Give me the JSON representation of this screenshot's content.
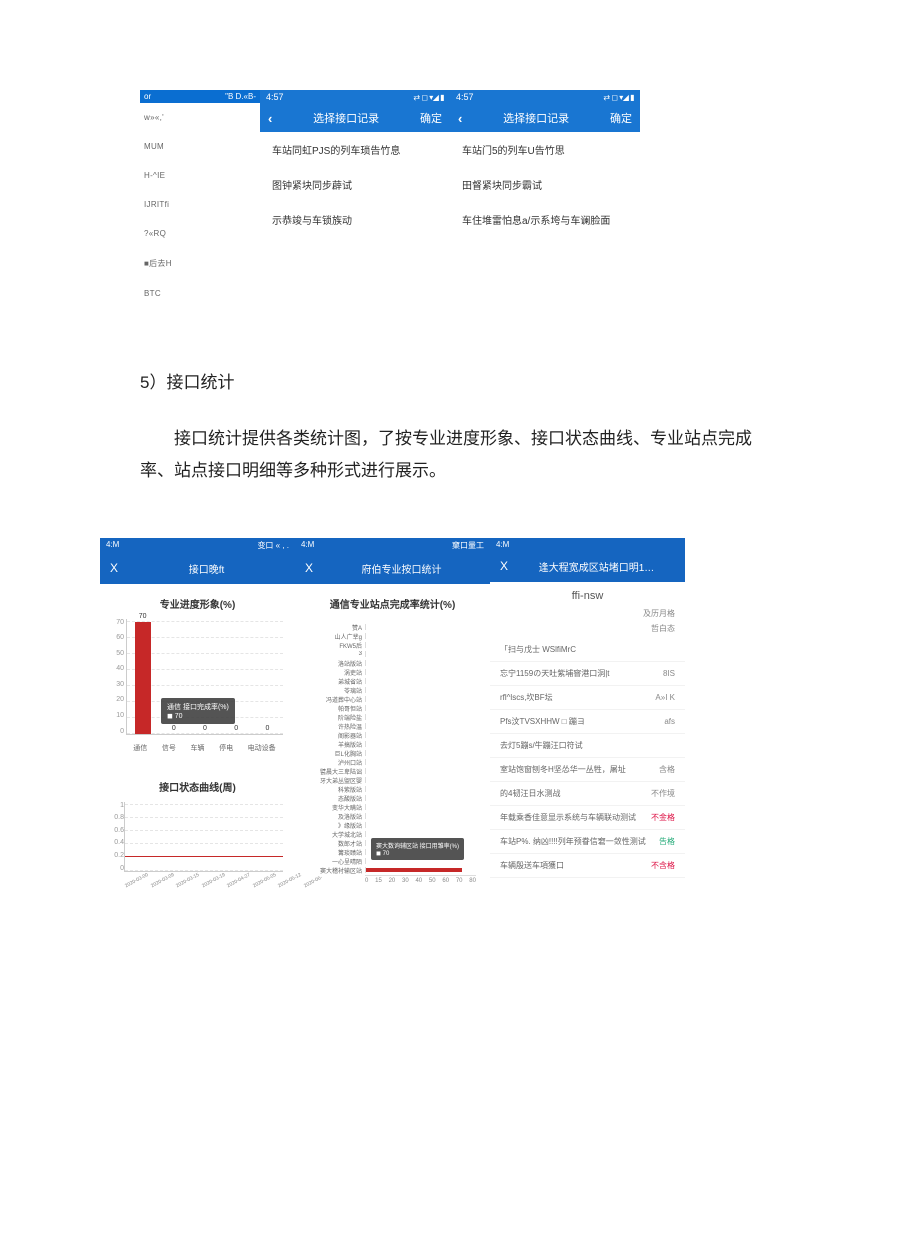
{
  "top_row": {
    "phone_a": {
      "hdr_left": "or",
      "hdr_right": "\"B D.«B-",
      "items": [
        "w»«,'",
        "MUM",
        "H-^IE",
        "IJRITfi",
        "?«RQ",
        "■后去H",
        "BTC"
      ]
    },
    "phone_b": {
      "time": "4:57",
      "status_icons": "⇄ ◻ ▾◢ ▮",
      "back": "‹",
      "title": "选择接口记录",
      "action": "确定",
      "items": [
        "车站同虹PJS的列车琐告竹息",
        "图钟紧块同步薜试",
        "示恭竣与车锁族动"
      ]
    },
    "phone_c": {
      "time": "4:57",
      "status_icons": "⇄ ◻ ▾◢ ▮",
      "back": "‹",
      "title": "选择接口记录",
      "action": "确定",
      "items": [
        "车站门5的列车U告竹思",
        "田督紧块同步霸试",
        "车住堆雷怕息a/示系垮与车谰脸面"
      ]
    }
  },
  "section": {
    "heading": "5）接口统计",
    "para": "接口统计提供各类统计图，了按专业进度形象、接口状态曲线、专业站点完成率、站点接口明细等多种形式进行展示。"
  },
  "bottom_row": {
    "phone_a": {
      "sb_left": "4:M",
      "sb_right": "变口 « , .",
      "close": "X",
      "title": "接口晚ft",
      "chart1_title": "专业进度形象(%)",
      "chart2_title": "接口状态曲线(周)"
    },
    "phone_b": {
      "sb_left": "4:M",
      "sb_right": "窠口量工",
      "close": "X",
      "title": "府伯专业按口统计",
      "chart_title": "通信专业站点完成率统计(%)"
    },
    "phone_c": {
      "sb_left": "4:M",
      "sb_right": "",
      "close": "X",
      "title": "逢大程宽成区站堵口明1…",
      "sub": "ffi-nsw",
      "tag1": "及历月格",
      "tag2": "哲白态",
      "rows": [
        {
          "l": "「扫与戊士 WSlfiMrC",
          "v": ""
        },
        {
          "l": "忘宁1159の天吐紫埔窨港口洞|t",
          "v": "8IS"
        },
        {
          "l": "rfl^lscs,坎BF坛",
          "v": "A»I K"
        },
        {
          "l": "Pfs汶TVSXHHW □ 蹦ヨ",
          "v": "afs"
        },
        {
          "l": "去灯5蹦s/牛蹦汪口符试",
          "v": ""
        },
        {
          "l": "室站饱窗刨冬H坚怂华一丛牲，屠址",
          "v": "含格"
        },
        {
          "l": "的4韧汪日水测战",
          "v": "不作境"
        },
        {
          "l": "年载乘香佳意显示系统与车辆联动测试",
          "v": "不金格",
          "cls": "red"
        },
        {
          "l": "车站P%.  纳凶!!!!列年预眷信窘一敛性测试",
          "v": "告格",
          "cls": "green"
        },
        {
          "l": "车辆殷送车項獲口",
          "v": "不含格",
          "cls": "red"
        }
      ]
    }
  },
  "chart_data": [
    {
      "type": "bar",
      "title": "专业进度形象(%)",
      "categories": [
        "通信",
        "信号",
        "车辆",
        "停电",
        "电动设备"
      ],
      "values": [
        70,
        0,
        0,
        0,
        0
      ],
      "ylim": [
        0,
        70
      ],
      "yticks": [
        0,
        10,
        20,
        30,
        40,
        50,
        60,
        70
      ],
      "legend": {
        "label": "通信 接口完成率(%)",
        "value": 70
      }
    },
    {
      "type": "line",
      "title": "接口状态曲线(周)",
      "x": [
        "2020-03-00",
        "2020-03-09",
        "2020-03-15",
        "2020-03-19",
        "2020-04-27",
        "2020-05-05",
        "2020-05-12",
        "2020-06-"
      ],
      "y": [
        0.2,
        0.2,
        0.2,
        0.2,
        0.2,
        0.2,
        0.2,
        0.2
      ],
      "ylim": [
        0,
        1
      ],
      "yticks": [
        0,
        0.2,
        0.4,
        0.6,
        0.8,
        1
      ]
    },
    {
      "type": "bar",
      "orientation": "horizontal",
      "title": "通信专业站点完成率统计(%)",
      "categories": [
        "赞A",
        "山人广丵g",
        "FKW5后",
        "3",
        "洛站版站",
        "涡吏站",
        "弟城省站",
        "苓璃站",
        "冯道葬中心站",
        "帕哥怛站",
        "阶端险盐",
        "许热险温",
        "阁影器站",
        "羊搞版站",
        "巨L化胸站",
        "泸州口站",
        "甓晨大三卑陆诎",
        "牙大弟丛盥区婴",
        "科紫版站",
        "态酸版站",
        "变华大瞒站",
        "及洛版站",
        "》缘版站",
        "大学城北站",
        "数郎才站",
        "篝琰赜站",
        "一心呈晴陌",
        "窦大稽衬输区站"
      ],
      "values": [
        0,
        0,
        0,
        0,
        0,
        0,
        0,
        0,
        0,
        0,
        0,
        0,
        0,
        0,
        0,
        0,
        0,
        0,
        0,
        0,
        0,
        0,
        0,
        0,
        0,
        0,
        0,
        70
      ],
      "xlim": [
        0,
        80
      ],
      "xticks": [
        0,
        15,
        20,
        30,
        40,
        50,
        60,
        70,
        80
      ],
      "legend": {
        "label": "窦大数询辅区站 接口用雏率(%)",
        "value": 70
      }
    }
  ]
}
